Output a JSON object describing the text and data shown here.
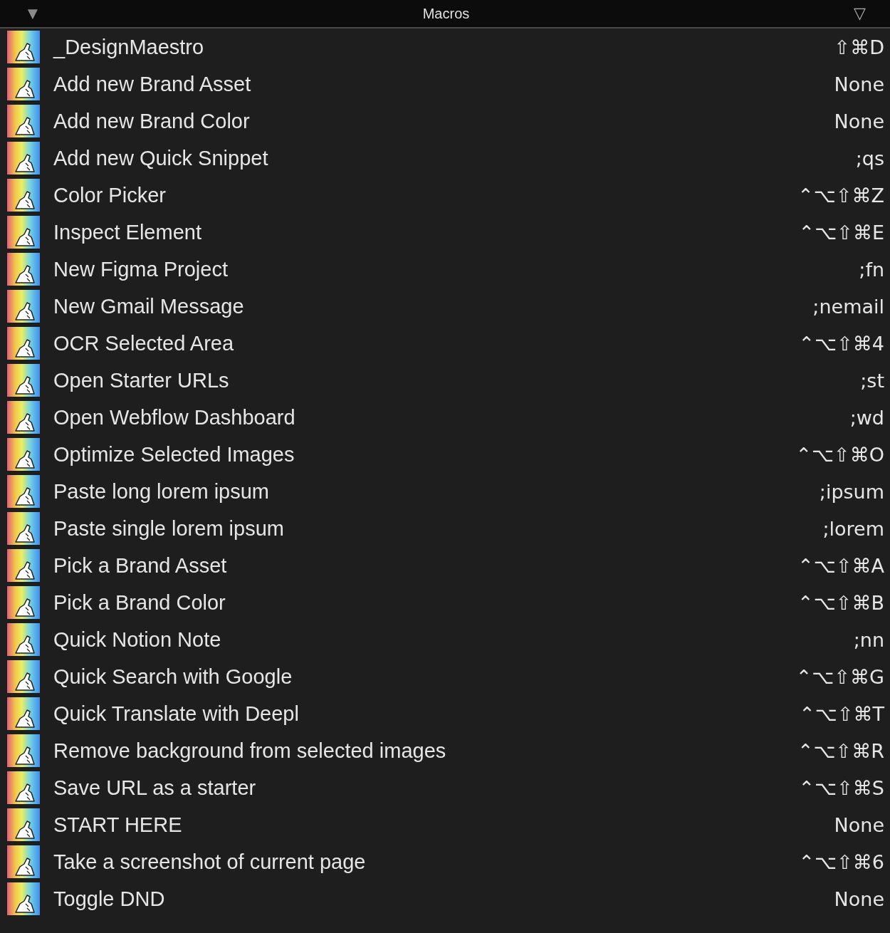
{
  "header": {
    "collapse_glyph": "▼",
    "title": "Macros",
    "sort_glyph": "▽"
  },
  "macros": [
    {
      "name": "_DesignMaestro",
      "trigger": "⇧⌘D"
    },
    {
      "name": "Add new Brand Asset",
      "trigger": "None"
    },
    {
      "name": "Add new Brand Color",
      "trigger": "None"
    },
    {
      "name": "Add new Quick Snippet",
      "trigger": ";qs"
    },
    {
      "name": "Color Picker",
      "trigger": "⌃⌥⇧⌘Z"
    },
    {
      "name": "Inspect Element",
      "trigger": "⌃⌥⇧⌘E"
    },
    {
      "name": "New Figma Project",
      "trigger": ";fn"
    },
    {
      "name": "New Gmail Message",
      "trigger": ";nemail"
    },
    {
      "name": "OCR Selected Area",
      "trigger": "⌃⌥⇧⌘4"
    },
    {
      "name": "Open Starter URLs",
      "trigger": ";st"
    },
    {
      "name": "Open Webflow Dashboard",
      "trigger": ";wd"
    },
    {
      "name": "Optimize Selected Images",
      "trigger": "⌃⌥⇧⌘O"
    },
    {
      "name": "Paste long lorem ipsum",
      "trigger": ";ipsum"
    },
    {
      "name": "Paste single lorem ipsum",
      "trigger": ";lorem"
    },
    {
      "name": "Pick a Brand Asset",
      "trigger": "⌃⌥⇧⌘A"
    },
    {
      "name": "Pick a Brand Color",
      "trigger": "⌃⌥⇧⌘B"
    },
    {
      "name": "Quick Notion Note",
      "trigger": ";nn"
    },
    {
      "name": "Quick Search with Google",
      "trigger": "⌃⌥⇧⌘G"
    },
    {
      "name": "Quick Translate with Deepl",
      "trigger": "⌃⌥⇧⌘T"
    },
    {
      "name": "Remove background from selected images",
      "trigger": "⌃⌥⇧⌘R"
    },
    {
      "name": "Save URL as a starter",
      "trigger": "⌃⌥⇧⌘S"
    },
    {
      "name": "START HERE",
      "trigger": "None"
    },
    {
      "name": "Take a screenshot of current page",
      "trigger": "⌃⌥⇧⌘6"
    },
    {
      "name": "Toggle DND",
      "trigger": "None"
    }
  ]
}
